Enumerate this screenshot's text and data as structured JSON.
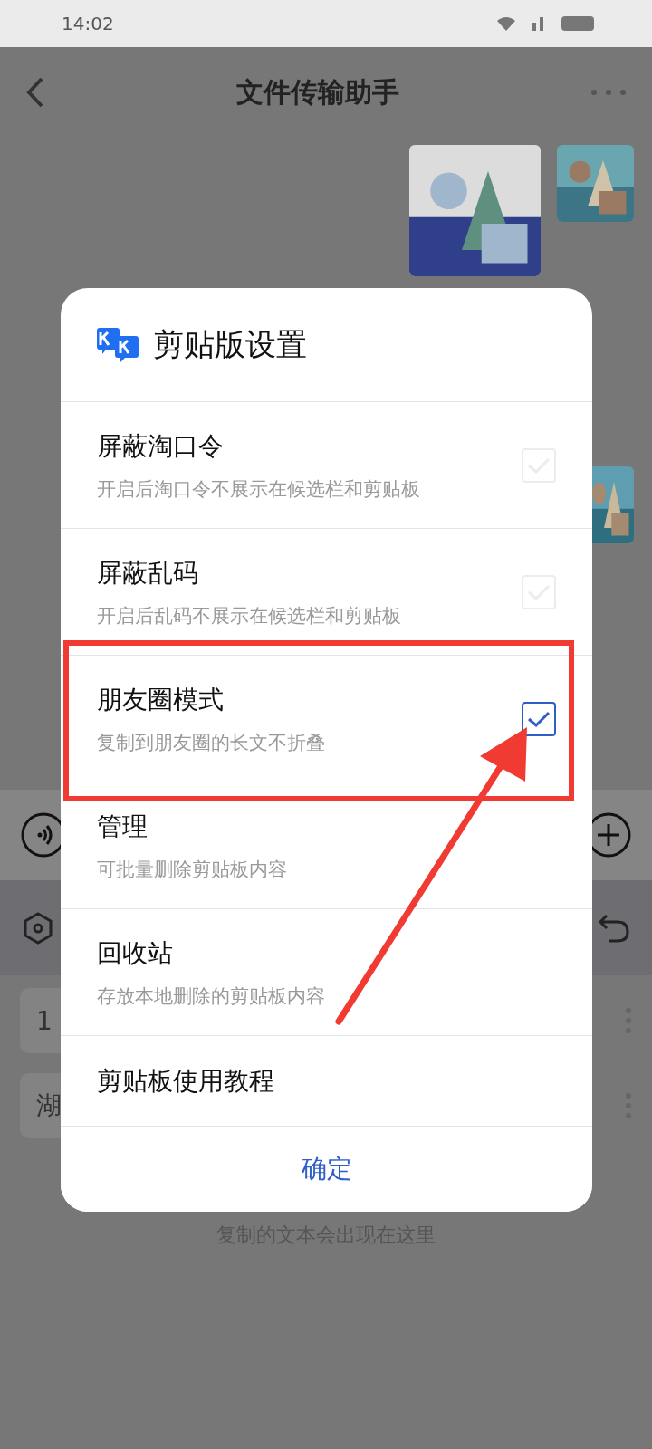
{
  "status_bar": {
    "time": "14:02"
  },
  "header": {
    "title": "文件传输助手"
  },
  "clipboard_panel": {
    "items": [
      {
        "label": "1"
      },
      {
        "label": "湖"
      }
    ],
    "hint": "复制的文本会出现在这里"
  },
  "dialog": {
    "title": "剪贴版设置",
    "options": [
      {
        "kind": "checkbox",
        "title": "屏蔽淘口令",
        "subtitle": "开启后淘口令不展示在候选栏和剪贴板",
        "checked": false
      },
      {
        "kind": "checkbox",
        "title": "屏蔽乱码",
        "subtitle": "开启后乱码不展示在候选栏和剪贴板",
        "checked": false
      },
      {
        "kind": "checkbox",
        "title": "朋友圈模式",
        "subtitle": "复制到朋友圈的长文不折叠",
        "checked": true
      },
      {
        "kind": "link",
        "title": "管理",
        "subtitle": "可批量删除剪贴板内容"
      },
      {
        "kind": "link",
        "title": "回收站",
        "subtitle": "存放本地删除的剪贴板内容"
      },
      {
        "kind": "link",
        "title": "剪贴板使用教程"
      }
    ],
    "confirm": "确定"
  }
}
